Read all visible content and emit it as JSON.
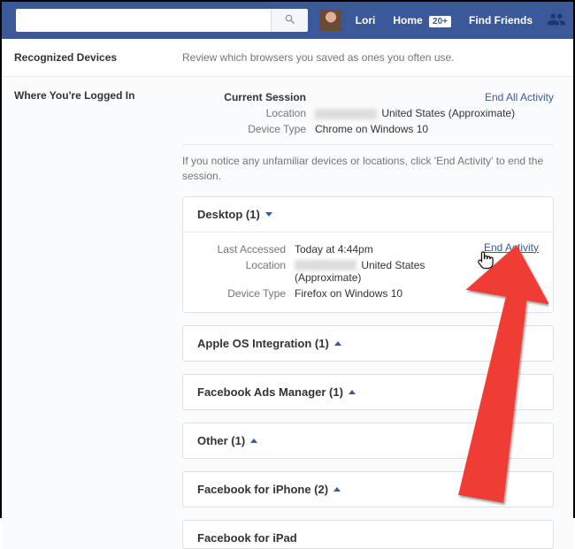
{
  "header": {
    "profile_name": "Lori",
    "home_label": "Home",
    "home_badge": "20+",
    "find_friends_label": "Find Friends",
    "search_placeholder": ""
  },
  "recognized": {
    "label": "Recognized Devices",
    "desc": "Review which browsers you saved as ones you often use."
  },
  "logged_in": {
    "label": "Where You're Logged In",
    "current_session_label": "Current Session",
    "end_all_label": "End All Activity",
    "location_label": "Location",
    "location_value": "United States (Approximate)",
    "device_type_label": "Device Type",
    "device_type_value": "Chrome on Windows 10",
    "notice": "If you notice any unfamiliar devices or locations, click 'End Activity' to end the session."
  },
  "desktop_card": {
    "title": "Desktop (1)",
    "last_accessed_label": "Last Accessed",
    "last_accessed_value": "Today at 4:44pm",
    "location_label": "Location",
    "location_value": "United States (Approximate)",
    "device_type_label": "Device Type",
    "device_type_value": "Firefox on Windows 10",
    "end_activity_label": "End Activity"
  },
  "cards": [
    {
      "title": "Apple OS Integration (1)"
    },
    {
      "title": "Facebook Ads Manager (1)"
    },
    {
      "title": "Other (1)"
    },
    {
      "title": "Facebook for iPhone (2)"
    },
    {
      "title": "Facebook for iPad"
    }
  ]
}
